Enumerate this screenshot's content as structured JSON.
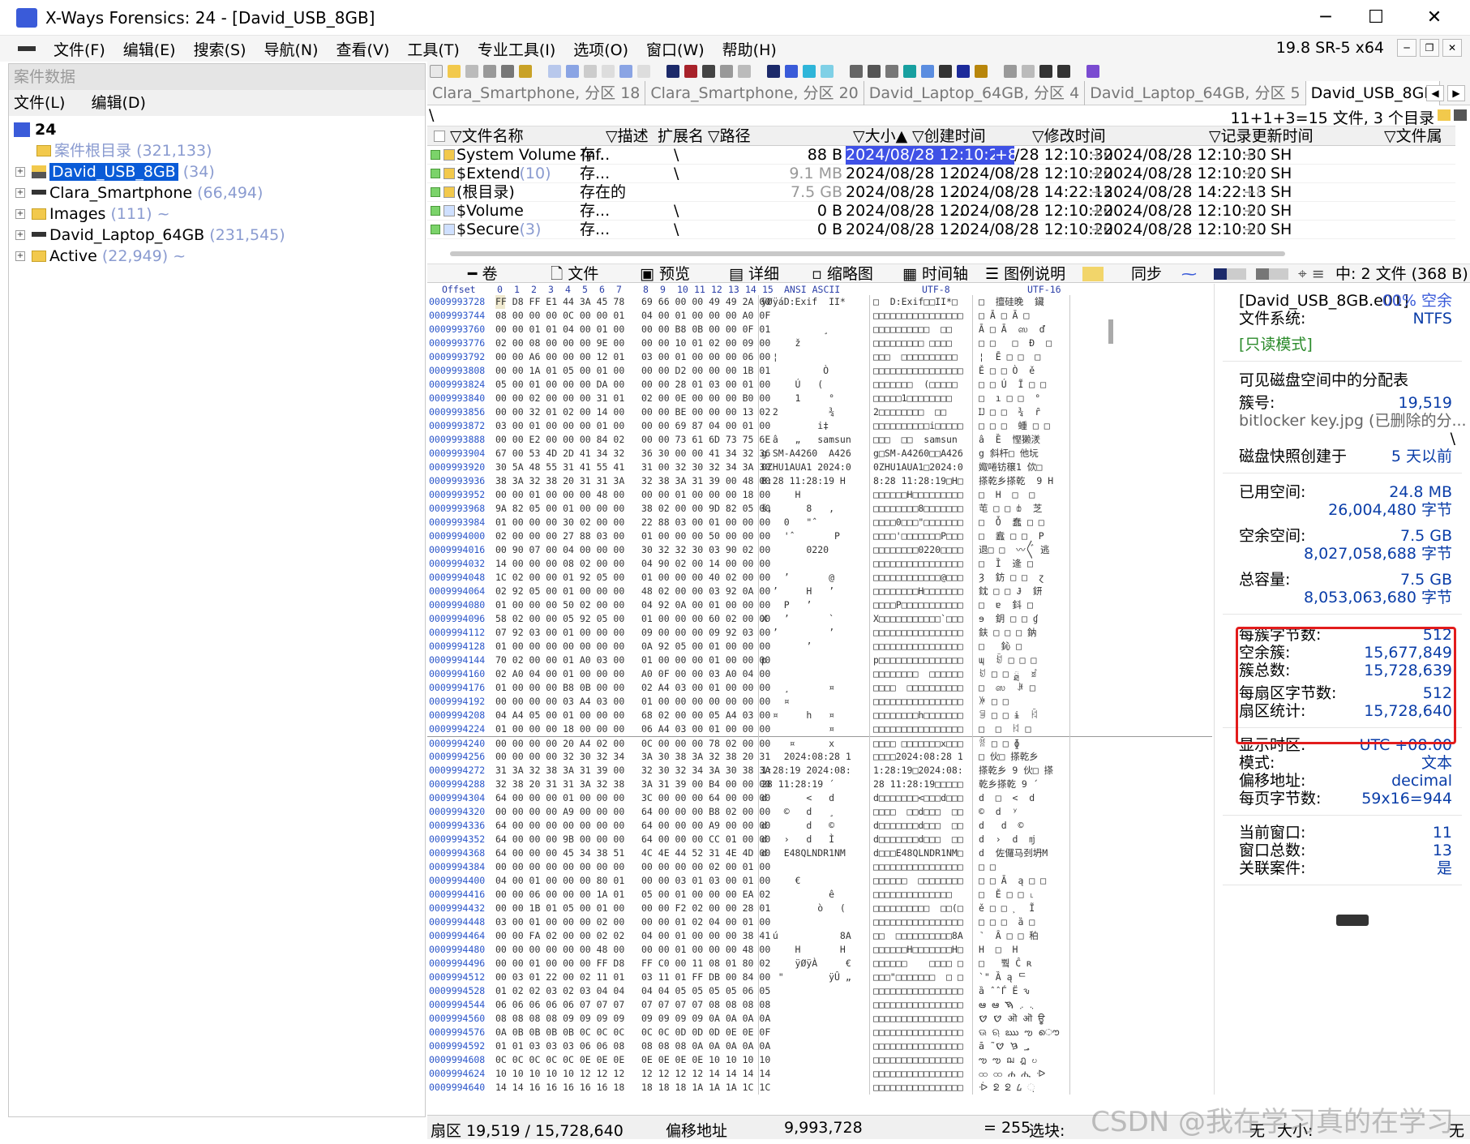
{
  "window": {
    "title": "X-Ways Forensics: 24 - [David_USB_8GB]",
    "min": "─",
    "max": "☐",
    "close": "✕"
  },
  "menu": [
    "文件(F)",
    "编辑(E)",
    "搜索(S)",
    "导航(N)",
    "查看(V)",
    "工具(T)",
    "专业工具(I)",
    "选项(O)",
    "窗口(W)",
    "帮助(H)"
  ],
  "version": "19.8 SR-5 x64",
  "case_panel": {
    "header": "案件数据",
    "menu": [
      "文件(L)",
      "编辑(D)"
    ],
    "root": "24",
    "items": [
      {
        "label": "案件根目录",
        "count": "(321,133)",
        "icon": "folder-icon"
      },
      {
        "label": "David_USB_8GB",
        "count": "(34)",
        "icon": "usb-icon",
        "selected": true
      },
      {
        "label": "Clara_Smartphone",
        "count": "(66,494)",
        "icon": "drive-icon"
      },
      {
        "label": "Images",
        "count": "(111)",
        "icon": "folder-icon",
        "suffix": "~"
      },
      {
        "label": "David_Laptop_64GB",
        "count": "(231,545)",
        "icon": "drive-icon"
      },
      {
        "label": "Active",
        "count": "(22,949)",
        "icon": "folder-icon",
        "suffix": "~"
      }
    ]
  },
  "tabs": [
    "Clara_Smartphone, 分区 18",
    "Clara_Smartphone, 分区 20",
    "David_Laptop_64GB, 分区 4",
    "David_Laptop_64GB, 分区 5",
    "David_USB_8GB"
  ],
  "path": {
    "root": "\\",
    "summary": "11+1+3=15 文件, 3 个目录"
  },
  "file_columns": [
    "文件名称",
    "描述",
    "扩展名",
    "路径",
    "大小",
    "创建时间",
    "修改时间",
    "记录更新时间",
    "文件属"
  ],
  "files": [
    {
      "name": "System Volume Inf...",
      "count": "",
      "desc": "存...",
      "path": "\\",
      "size": "88 B",
      "created": "2024/08/28  12:10:28",
      "created_suffix": "+8",
      "modified": "/28  12:10:30",
      "mod_prefix": "",
      "mod_suffix": "+8",
      "record": "2024/08/28  12:10:30",
      "rec_suffix": "+8",
      "attr": "SH",
      "highlight": true
    },
    {
      "name": "$Extend",
      "count": "(10)",
      "desc": "存...",
      "path": "\\",
      "size": "9.1 MB",
      "created": "2024/08/28  1...",
      "modified": "2024/08/28  12:10:20",
      "mod_suffix": "+8",
      "record": "2024/08/28  12:10:20",
      "rec_suffix": "+8",
      "attr": "SH",
      "size_gray": true
    },
    {
      "name": "(根目录)",
      "count": "",
      "desc": "存在的",
      "path": "",
      "size": "7.5 GB",
      "created": "2024/08/28  1...",
      "modified": "2024/08/28  14:22:13",
      "mod_suffix": "+8",
      "record": "2024/08/28  14:22:13",
      "rec_suffix": "+8",
      "attr": "SH",
      "size_gray": true
    },
    {
      "name": "$Volume",
      "count": "",
      "desc": "存...",
      "path": "\\",
      "size": "0 B",
      "created": "2024/08/28  1...",
      "modified": "2024/08/28  12:10:20",
      "mod_suffix": "+8",
      "record": "2024/08/28  12:10:20",
      "rec_suffix": "+8",
      "attr": "SH"
    },
    {
      "name": "$Secure",
      "count": "(3)",
      "desc": "存...",
      "path": "\\",
      "size": "0 B",
      "created": "2024/08/28  1...",
      "modified": "2024/08/28  12:10:20",
      "mod_suffix": "+8",
      "record": "2024/08/28  12:10:20",
      "rec_suffix": "+8",
      "attr": "SH"
    }
  ],
  "view_tabs": [
    "卷",
    "文件",
    "预览",
    "详细",
    "缩略图",
    "时间轴",
    "图例说明",
    "同步",
    "中: 2 文件 (368 B)"
  ],
  "hex_header": {
    "offset": "Offset",
    "cols": [
      "0",
      "1",
      "2",
      "3",
      "4",
      "5",
      "6",
      "7",
      "8",
      "9",
      "10",
      "11",
      "12",
      "13",
      "14",
      "15"
    ],
    "ansi": "ANSI ASCII",
    "utf8": "UTF-8",
    "utf16": "UTF-16"
  },
  "hex_rows": [
    {
      "o": "0009993728",
      "b": "FF D8 FF E1 44 3A 45 78   69 66 00 00 49 49 2A 00",
      "a": "ÿØÿáD:Exif  II*",
      "u": "□  D:Exif□□II*□",
      "w": "□  擅硅晚  鑶"
    },
    {
      "o": "0009993744",
      "b": "08 00 00 00 0C 00 00 01   04 00 01 00 00 00 A0 0F",
      "a": "",
      "u": "□□□□□□□□□□□□□□□□",
      "w": "□ Ā □ Ā □"
    },
    {
      "o": "0009993760",
      "b": "00 00 01 01 04 00 01 00   00 00 B8 0B 00 00 0F 01",
      "a": "           ¸",
      "u": "□□□□□□□□□□  □□",
      "w": "Ā □ Ā  ஸ  ď"
    },
    {
      "o": "0009993776",
      "b": "02 00 08 00 00 00 9E 00   00 00 10 01 02 00 09 00",
      "a": "      ž",
      "u": "□□□□□□□□□ □□□□",
      "w": "□ □   □  Đ  □"
    },
    {
      "o": "0009993792",
      "b": "00 00 A6 00 00 00 12 01   03 00 01 00 00 00 06 00",
      "a": "  ¦",
      "u": "□□□  □□□□□□□□□□",
      "w": "¦  Ē □ □  □"
    },
    {
      "o": "0009993808",
      "b": "00 00 1A 01 05 00 01 00   00 00 D2 00 00 00 1B 01",
      "a": "           Ò",
      "u": "□□□□□□□□□□□□□□□□",
      "w": "Ě □ □ Ò  ě"
    },
    {
      "o": "0009993824",
      "b": "05 00 01 00 00 00 DA 00   00 00 28 01 03 00 01 00",
      "a": "      Ú   (",
      "u": "□□□□□□□  (□□□□□",
      "w": "□ □ Ú  Ĩ □ □"
    },
    {
      "o": "0009993840",
      "b": "00 00 02 00 00 00 31 01   02 00 0E 00 00 00 B0 00",
      "a": "      1     °",
      "u": "□□□□□1□□□□□□□□",
      "w": "□  ı □ □  °"
    },
    {
      "o": "0009993856",
      "b": "00 00 32 01 02 00 14 00   00 00 BE 00 00 00 13 02",
      "a": "  2         ¾",
      "u": "2□□□□□□□□  □□",
      "w": "Ĳ □ □  ¾  ȓ"
    },
    {
      "o": "0009993872",
      "b": "03 00 01 00 00 00 01 00   00 00 69 87 04 00 01 00",
      "a": "          i‡",
      "u": "□□□□□□□□□□i□□□□□",
      "w": "□ □ □  蝩 □ □"
    },
    {
      "o": "0009993888",
      "b": "00 00 E2 00 00 00 84 02   00 00 73 61 6D 73 75 6E",
      "a": "  â   „   samsun",
      "u": "□□□  □□  samsun",
      "w": "â  Ȅ  慳獭湵"
    },
    {
      "o": "0009993904",
      "b": "67 00 53 4D 2D 41 34 32   36 30 00 00 41 34 32 36",
      "a": "g SM-A4260  A426",
      "u": "g□SM-A4260□□A426",
      "w": "g 斜杆□ 他坃"
    },
    {
      "o": "0009993920",
      "b": "30 5A 48 55 31 41 55 41   31 00 32 30 32 34 3A 30",
      "a": "0ZHU1AUA1 2024:0",
      "u": "0ZHU1AUA1□2024:0",
      "w": "娵啳钫穣1 佽□"
    },
    {
      "o": "0009993936",
      "b": "38 3A 32 38 20 31 31 3A   32 38 3A 31 39 00 48 00",
      "a": "8:28 11:28:19 H",
      "u": "8:28 11:28:19□H□",
      "w": "搽乾乡搽乾  9 H"
    },
    {
      "o": "0009993952",
      "b": "00 00 01 00 00 00 48 00   00 00 01 00 00 00 18 00",
      "a": "      H",
      "u": "□□□□□□H□□□□□□□□□",
      "w": "□  H  □  □"
    },
    {
      "o": "0009993968",
      "b": "9A 82 05 00 01 00 00 00   38 02 00 00 9D 82 05 00",
      "a": "š‚      8   ‚",
      "u": "□□□□□□□□8□□□□□□□",
      "w": "芚 □ □ ȸ  芝"
    },
    {
      "o": "0009993984",
      "b": "01 00 00 00 30 02 00 00   22 88 03 00 01 00 00 00",
      "a": "    0   \"ˆ",
      "u": "□□□□0□□□\"□□□□□□□",
      "w": "□  Ȱ  蠢 □ □"
    },
    {
      "o": "0009994000",
      "b": "02 00 00 00 27 88 03 00   01 00 00 00 50 00 00 00",
      "a": "    'ˆ       P",
      "u": "□□□□'□□□□□□□P□□□",
      "w": "□  蠧 □ □  P"
    },
    {
      "o": "0009994016",
      "b": "00 90 07 00 04 00 00 00   30 32 32 30 03 90 02 00",
      "a": "        0220",
      "u": "□□□□□□□□0220□□□□",
      "w": "退□ □  〰〲 逃"
    },
    {
      "o": "0009994032",
      "b": "14 00 00 00 08 02 00 00   04 90 02 00 14 00 00 00",
      "a": "",
      "u": "□□□□□□□□□□□□□□□□",
      "w": "□  Ȉ  逄 □"
    },
    {
      "o": "0009994048",
      "b": "1C 02 00 00 01 92 05 00   01 00 00 00 40 02 00 00",
      "a": "    ’       @",
      "u": "□□□□□□□□□□□□@□□□",
      "w": "Ȝ  鈁 □ □  ɀ"
    },
    {
      "o": "0009994064",
      "b": "02 92 05 00 01 00 00 00   48 02 00 00 03 92 0A 00",
      "a": "  ’     H   ’",
      "u": "□□□□□□□□H□□□□□□□",
      "w": "鈂 □ □ Ɉ  鈃"
    },
    {
      "o": "0009994080",
      "b": "01 00 00 00 50 02 00 00   04 92 0A 00 01 00 00 00",
      "a": "    P   ’",
      "u": "□□□□P□□□□□□□□□□□",
      "w": "□  ɐ  鈄 □"
    },
    {
      "o": "0009994096",
      "b": "58 02 00 00 05 92 05 00   01 00 00 00 60 02 00 00",
      "a": "X   ’       `",
      "u": "X□□□□□□□□□□□`□□□",
      "w": "ɘ  鈅 □ □ ɠ"
    },
    {
      "o": "0009994112",
      "b": "07 92 03 00 01 00 00 00   09 00 00 00 09 92 03 00",
      "a": "  ’         ’",
      "u": "□□□□□□□□□□□□□□□□",
      "w": "鈇 □ □ □ 鈉"
    },
    {
      "o": "0009994128",
      "b": "01 00 00 00 00 00 00 00   0A 92 05 00 01 00 00 00",
      "a": "        ’",
      "u": "□□□□□□□□□□□□□□□□",
      "w": "□   鈊 □"
    },
    {
      "o": "0009994144",
      "b": "70 02 00 00 01 A0 03 00   01 00 00 00 01 00 00 00",
      "a": "p",
      "u": "p□□□□□□□□□□□□□□□",
      "w": "ɰ  ꀁ □ □ □"
    },
    {
      "o": "0009994160",
      "b": "02 A0 04 00 01 00 00 00   A0 0F 00 00 03 A0 04 00",
      "a": "",
      "u": "□□□□□□□□  □□□□□□",
      "w": "ꀂ □ □ ྠ  ꀃ"
    },
    {
      "o": "0009994176",
      "b": "01 00 00 00 B8 0B 00 00   02 A4 03 00 01 00 00 00",
      "a": "    ¸       ¤",
      "u": "□□□□  □□□□□□□□□□",
      "w": "□  ஸ  ꐂ □"
    },
    {
      "o": "0009994192",
      "b": "00 00 00 00 03 A4 03 00   01 00 00 00 00 00 00 00",
      "a": "    ¤",
      "u": "□□□□□□□□□□□□□□□□",
      "w": "ꐃ □ □"
    },
    {
      "o": "0009994208",
      "b": "04 A4 05 00 01 00 00 00   68 02 00 00 05 A4 03 00",
      "a": "  ¤     h   ¤",
      "u": "□□□□□□□□h□□□□□□□",
      "w": "ꐄ □ □ ɨ  ꐅ"
    },
    {
      "o": "0009994224",
      "b": "01 00 00 00 18 00 00 00   06 A4 03 00 01 00 00 00",
      "a": "            ¤",
      "u": "□□□□□□□□□□□□□□□□",
      "w": "□  □  ꐆ □"
    },
    {
      "o": "0009994240",
      "b": "00 00 00 00 20 A4 02 00   0C 00 00 00 78 02 00 00",
      "a": "     ¤      x",
      "u": "□□□□ □□□□□□□x□□□",
      "w": "ꐠ □ □ ɸ"
    },
    {
      "o": "0009994256",
      "b": "00 00 00 00 32 30 32 34   3A 30 38 3A 32 38 20 31",
      "a": "    2024:08:28 1",
      "u": "□□□□2024:08:28 1",
      "w": "□ 伙□ 搽乾乡"
    },
    {
      "o": "0009994272",
      "b": "31 3A 32 38 3A 31 39 00   32 30 32 34 3A 30 38 3A",
      "a": "1:28:19 2024:08:",
      "u": "1:28:19□2024:08:",
      "w": "搽乾乡 9 伙□ 搽"
    },
    {
      "o": "0009994288",
      "b": "32 38 20 31 31 3A 32 38   3A 31 39 00 B4 00 00 00",
      "a": "28 11:28:19 ´",
      "u": "28 11:28:19□□□□□",
      "w": "乾乡搽乾 9 ´"
    },
    {
      "o": "0009994304",
      "b": "64 00 00 00 01 00 00 00   3C 00 00 00 64 00 00 00",
      "a": "d       <   d",
      "u": "d□□□□□□□<□□□d□□□",
      "w": "d  □  <  d"
    },
    {
      "o": "0009994320",
      "b": "00 00 00 00 A9 00 00 00   64 00 00 00 B8 02 00 00",
      "a": "    ©   d   ¸",
      "u": "□□□□  □□d□□□  □□",
      "w": "©  d  ʸ"
    },
    {
      "o": "0009994336",
      "b": "64 00 00 00 00 00 00 00   64 00 00 00 A9 00 00 00",
      "a": "d       d   ©",
      "u": "d□□□□□□□d□□□  □□",
      "w": "d   d  ©"
    },
    {
      "o": "0009994352",
      "b": "64 00 00 00 9B 00 00 00   64 00 00 00 CC 01 00 00",
      "a": "d   ›   d   Ì",
      "u": "d□□□□□□□d□□□  □□",
      "w": "d  ›  d  ǌ"
    },
    {
      "o": "0009994368",
      "b": "64 00 00 00 45 34 38 51   4C 4E 44 52 31 4E 4D 00",
      "a": "d   E48QLNDR1NM",
      "u": "d□□□E48QLNDR1NM□",
      "w": "d  佐儸马刭坍M"
    },
    {
      "o": "0009994384",
      "b": "00 00 00 00 00 00 00 00   00 00 00 00 02 00 01 00",
      "a": "",
      "u": "□□□□□□□□□□□□□□□□",
      "w": "□ □"
    },
    {
      "o": "0009994400",
      "b": "04 00 01 00 00 00 80 01   00 00 03 01 03 00 01 00",
      "a": "      €",
      "u": "□□□□□□  □□□□□□□□",
      "w": "□ □ Ā  ą □ □"
    },
    {
      "o": "0009994416",
      "b": "00 00 06 00 00 00 1A 01   05 00 01 00 00 00 EA 02",
      "a": "            ê",
      "u": "□□□□□□□□□□□□□□  ",
      "w": "□  Ě □ □ ˪"
    },
    {
      "o": "0009994432",
      "b": "00 00 1B 01 05 00 01 00   00 00 F2 02 00 00 28 01",
      "a": "          ò   (",
      "u": "□□□□□□□□□□  □□(□",
      "w": "ě □ □ ˲  Ĩ"
    },
    {
      "o": "0009994448",
      "b": "03 00 01 00 00 00 02 00   00 00 01 02 04 00 01 00",
      "a": "",
      "u": "□□□□□□□□□□□□□□□□",
      "w": "□ □ □  ȁ □"
    },
    {
      "o": "0009994464",
      "b": "00 00 FA 02 00 00 02 02   04 00 01 00 00 00 38 41",
      "a": "  ú           8A",
      "u": "□□  □□□□□□□□□□8A",
      "w": "˺  Ȃ □ □ 䄸"
    },
    {
      "o": "0009994480",
      "b": "00 00 00 00 00 00 48 00   00 00 01 00 00 00 48 00",
      "a": "      H       H",
      "u": "□□□□□□H□□□□□□□H□",
      "w": "H  □  H"
    },
    {
      "o": "0009994496",
      "b": "00 00 01 00 00 00 FF D8   FF C0 00 11 08 01 80 02",
      "a": "      ÿØÿÀ     €",
      "u": "□□□□□□    □□□□ □",
      "w": "□  ￘ 쀀 Ĉ ʀ"
    },
    {
      "o": "0009994512",
      "b": "00 03 01 22 00 02 11 01   03 11 01 FF DB 00 84 00",
      "a": "   \"        ÿÛ „",
      "u": "□□□\"□□□□□□□  □ □",
      "w": "̀ \" Ȁ ą ᄃ"
    },
    {
      "o": "0009994528",
      "b": "01 02 02 03 02 03 04 04   04 04 05 05 05 05 06 05",
      "a": "",
      "u": "□□□□□□□□□□□□□□□□",
      "w": "ȁ ̂ ̂ Ѓ Ё ԅ"
    },
    {
      "o": "0009994544",
      "b": "06 06 06 06 06 07 07 07   07 07 07 07 08 08 08 08",
      "a": "",
      "u": "□□□□□□□□□□□□□□□□",
      "w": "ఆ ఆ ܆ ܇ ࠇ"
    },
    {
      "o": "0009994560",
      "b": "08 08 08 08 09 09 09 09   09 09 09 09 0A 0A 0A 0A",
      "a": "",
      "u": "□□□□□□□□□□□□□□□□",
      "w": "ࠈ ࠈ ऒ ऒ ਊ"
    },
    {
      "o": "0009994576",
      "b": "0A 0B 0B 0B 0B 0C 0C 0C   0C 0C 0D 0D 0D 0E 0E 0F",
      "a": "",
      "u": "□□□□□□□□□□□□□□□□",
      "w": "ଊ ଋ ఋ ఌ ൌ"
    },
    {
      "o": "0009994592",
      "b": "01 01 03 03 03 06 06 08   08 08 08 0A 0A 0A 0A 0A",
      "a": "",
      "u": "□□□□□□□□□□□□□□□□",
      "w": "ā ̃ ؃ ࠆ ࠈ"
    },
    {
      "o": "0009994608",
      "b": "0C 0C 0C 0C 0C 0E 0E 0E   0E 0E 0E 0E 10 10 10 10",
      "a": "",
      "u": "□□□□□□□□□□□□□□□□",
      "w": "ఌ ఌ ฌ ฎ ဎ"
    },
    {
      "o": "0009994624",
      "b": "10 10 10 10 10 12 12 12   12 12 12 12 14 14 14 14",
      "a": "",
      "u": "□□□□□□□□□□□□□□□□",
      "w": "ထ ထ ሐ ሒ ᐒ"
    },
    {
      "o": "0009994640",
      "b": "14 14 16 16 16 16 16 18   18 18 18 1A 1A 1A 1C 1C",
      "a": "",
      "u": "□□□□□□□□□□□□□□□□",
      "w": "ᐔ ᘖ ᘖ ᠘ ᨘ"
    }
  ],
  "info": {
    "image_name": "[David_USB_8GB.e01]",
    "free_pct": "00% 空余",
    "fs_label": "文件系统:",
    "fs_value": "NTFS",
    "readonly": "[只读模式]",
    "alloc_title": "可见磁盘空间中的分配表",
    "cluster_label": "簇号:",
    "cluster_value": "19,519",
    "file_ref": "bitlocker key.jpg (已删除的分...",
    "backslash": "\\",
    "snapshot_label": "磁盘快照创建于",
    "snapshot_value": "5 天以前",
    "used_label": "已用空间:",
    "used_mb": "24.8 MB",
    "used_bytes": "26,004,480 字节",
    "free_label": "空余空间:",
    "free_gb": "7.5 GB",
    "free_bytes": "8,027,058,688 字节",
    "total_label": "总容量:",
    "total_gb": "7.5 GB",
    "total_bytes": "8,053,063,680 字节",
    "bpc_label": "每簇字节数:",
    "bpc_value": "512",
    "free_clusters_label": "空余簇:",
    "free_clusters_value": "15,677,849",
    "total_clusters_label": "簇总数:",
    "total_clusters_value": "15,728,639",
    "bps_label": "每扇区字节数:",
    "bps_value": "512",
    "sectors_label": "扇区统计:",
    "sectors_value": "15,728,640",
    "tz_label": "显示时区:",
    "tz_value": "UTC +08:00",
    "mode_label": "模式:",
    "mode_value": "文本",
    "offset_label": "偏移地址:",
    "offset_value": "decimal",
    "bpp_label": "每页字节数:",
    "bpp_value": "59x16=944",
    "curwin_label": "当前窗口:",
    "curwin_value": "11",
    "totwin_label": "窗口总数:",
    "totwin_value": "13",
    "assoc_label": "关联案件:",
    "assoc_value": "是"
  },
  "status": {
    "sector": "扇区 19,519 / 15,728,640",
    "offset_label": "偏移地址",
    "offset_value": "9,993,728",
    "eq": "= 255",
    "block_label": "选块:",
    "none": "无",
    "size_label": "大小:",
    "none2": "无"
  },
  "watermark": "CSDN @我在学习真的在学习",
  "accent": "#0a5bd7",
  "highlight_box_color": "#e21c1c"
}
